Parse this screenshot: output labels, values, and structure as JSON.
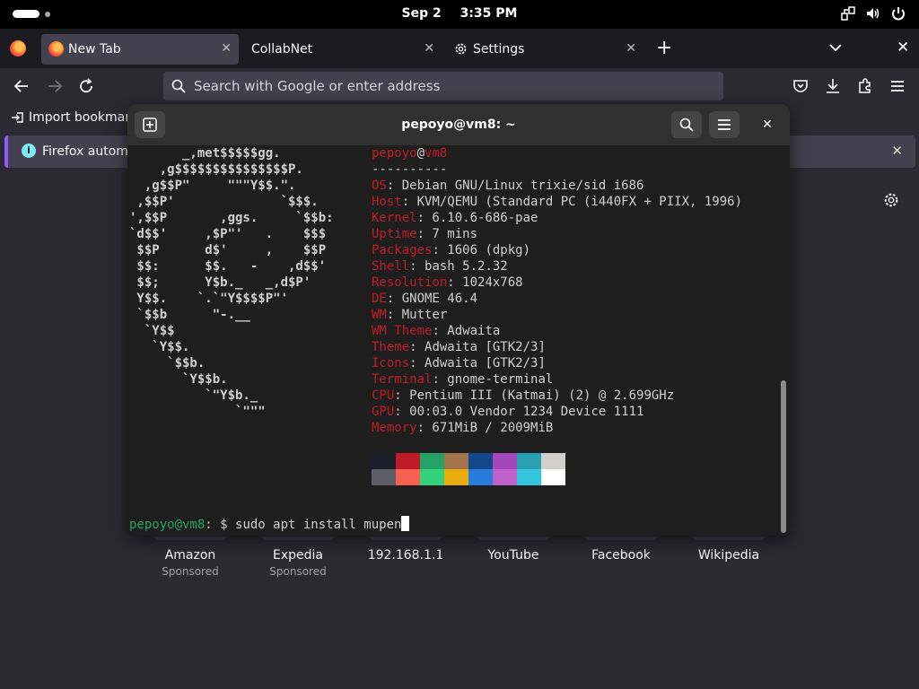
{
  "topbar": {
    "date": "Sep 2",
    "time": "3:35 PM"
  },
  "tabs": [
    {
      "label": "New Tab",
      "active": true
    },
    {
      "label": "CollabNet",
      "active": false
    },
    {
      "label": "Settings",
      "active": false
    }
  ],
  "urlbar": {
    "placeholder": "Search with Google or enter address"
  },
  "bookmarks": {
    "import_label": "Import bookmarks..."
  },
  "notification": {
    "text": "Firefox automa"
  },
  "shortcuts": [
    {
      "name": "Amazon",
      "sub": "Sponsored"
    },
    {
      "name": "Expedia",
      "sub": "Sponsored"
    },
    {
      "name": "192.168.1.1",
      "sub": ""
    },
    {
      "name": "YouTube",
      "sub": ""
    },
    {
      "name": "Facebook",
      "sub": ""
    },
    {
      "name": "Wikipedia",
      "sub": ""
    }
  ],
  "terminal": {
    "title": "pepoyo@vm8: ~",
    "user": "pepoyo",
    "host": "vm8",
    "separator": "----------",
    "info": [
      {
        "key": "OS",
        "value": "Debian GNU/Linux trixie/sid i686"
      },
      {
        "key": "Host",
        "value": "KVM/QEMU (Standard PC (i440FX + PIIX, 1996)"
      },
      {
        "key": "Kernel",
        "value": "6.10.6-686-pae"
      },
      {
        "key": "Uptime",
        "value": "7 mins"
      },
      {
        "key": "Packages",
        "value": "1606 (dpkg)"
      },
      {
        "key": "Shell",
        "value": "bash 5.2.32"
      },
      {
        "key": "Resolution",
        "value": "1024x768"
      },
      {
        "key": "DE",
        "value": "GNOME 46.4"
      },
      {
        "key": "WM",
        "value": "Mutter"
      },
      {
        "key": "WM Theme",
        "value": "Adwaita"
      },
      {
        "key": "Theme",
        "value": "Adwaita [GTK2/3]"
      },
      {
        "key": "Icons",
        "value": "Adwaita [GTK2/3]"
      },
      {
        "key": "Terminal",
        "value": "gnome-terminal"
      },
      {
        "key": "CPU",
        "value": "Pentium III (Katmai) (2) @ 2.699GHz"
      },
      {
        "key": "GPU",
        "value": "00:03.0 Vendor 1234 Device 1111"
      },
      {
        "key": "Memory",
        "value": "671MiB / 2009MiB"
      }
    ],
    "ascii_art": [
      "       _,met$$$$$gg.",
      "    ,g$$$$$$$$$$$$$$$P.",
      "  ,g$$P\"     \"\"\"Y$$.\".",
      " ,$$P'              `$$$.",
      "',$$P       ,ggs.     `$$b:",
      "`d$$'     ,$P\"'   .    $$$",
      " $$P      d$'     ,    $$P",
      " $$:      $$.   -    ,d$$'",
      " $$;      Y$b._   _,d$P'",
      " Y$$.    `.`\"Y$$$$P\"'",
      " `$$b      \"-.__",
      "  `Y$$",
      "   `Y$$.",
      "     `$$b.",
      "       `Y$$b.",
      "          `\"Y$b._",
      "              `\"\"\""
    ],
    "palette_top": [
      "#1e1d2a",
      "#c01c28",
      "#26a269",
      "#a2734c",
      "#12488b",
      "#a347ba",
      "#2aa1b3",
      "#d0cfcc"
    ],
    "palette_bottom": [
      "#5e5c64",
      "#f66151",
      "#33d17a",
      "#e9ad0c",
      "#2a7bde",
      "#c061cb",
      "#33c7de",
      "#ffffff"
    ],
    "prompt_user": "pepoyo@vm8",
    "prompt_suffix": ": $ ",
    "command": "sudo apt install mupen"
  }
}
